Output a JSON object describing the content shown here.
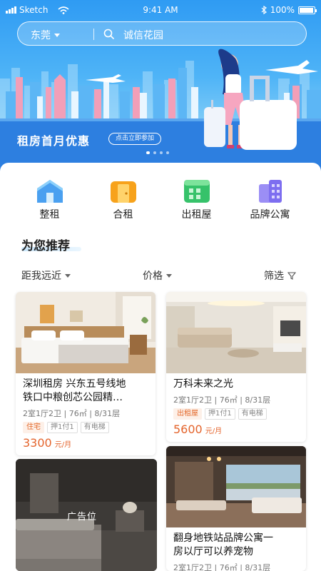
{
  "status_bar": {
    "carrier": "Sketch",
    "time": "9:41 AM",
    "battery": "100%"
  },
  "search": {
    "city": "东莞",
    "query": "诚信花园"
  },
  "banner": {
    "title": "租房首月优惠",
    "button_label": "点击立即参加",
    "page_dots": 4,
    "active_dot": 0
  },
  "categories": [
    {
      "label": "整租",
      "icon": "house-icon",
      "color": "#4aa0f0"
    },
    {
      "label": "合租",
      "icon": "door-icon",
      "color": "#f7a21b"
    },
    {
      "label": "出租屋",
      "icon": "building-icon",
      "color": "#36c26a"
    },
    {
      "label": "品牌公寓",
      "icon": "apartment-icon",
      "color": "#7d6ef0"
    }
  ],
  "section_title": "为您推荐",
  "filters": {
    "distance": "距我远近",
    "price": "价格",
    "filter": "筛选"
  },
  "listings": [
    {
      "title_line1": "深圳租房 兴东五号线地",
      "title_line2": "铁口中粮创芯公园精…",
      "meta": "2室1厅2卫 | 76㎡ | 8/31层",
      "tags": [
        "住宅",
        "押1付1",
        "有电梯"
      ],
      "price": "3300",
      "unit": "元/月"
    },
    {
      "title_line1": "万科未来之光",
      "meta": "2室1厅2卫 | 76㎡ | 8/31层",
      "tags": [
        "出租屋",
        "押1付1",
        "有电梯"
      ],
      "price": "5600",
      "unit": "元/月"
    },
    {
      "title_line1": "翻身地铁站品牌公寓一",
      "title_line2": "房以厅可以养宠物",
      "meta": "2室1厅2卫 | 76㎡ | 8/31层"
    }
  ],
  "ad": {
    "label": "广告位"
  },
  "colors": {
    "accent": "#e4642c",
    "brand_blue": "#2f9bf3"
  }
}
